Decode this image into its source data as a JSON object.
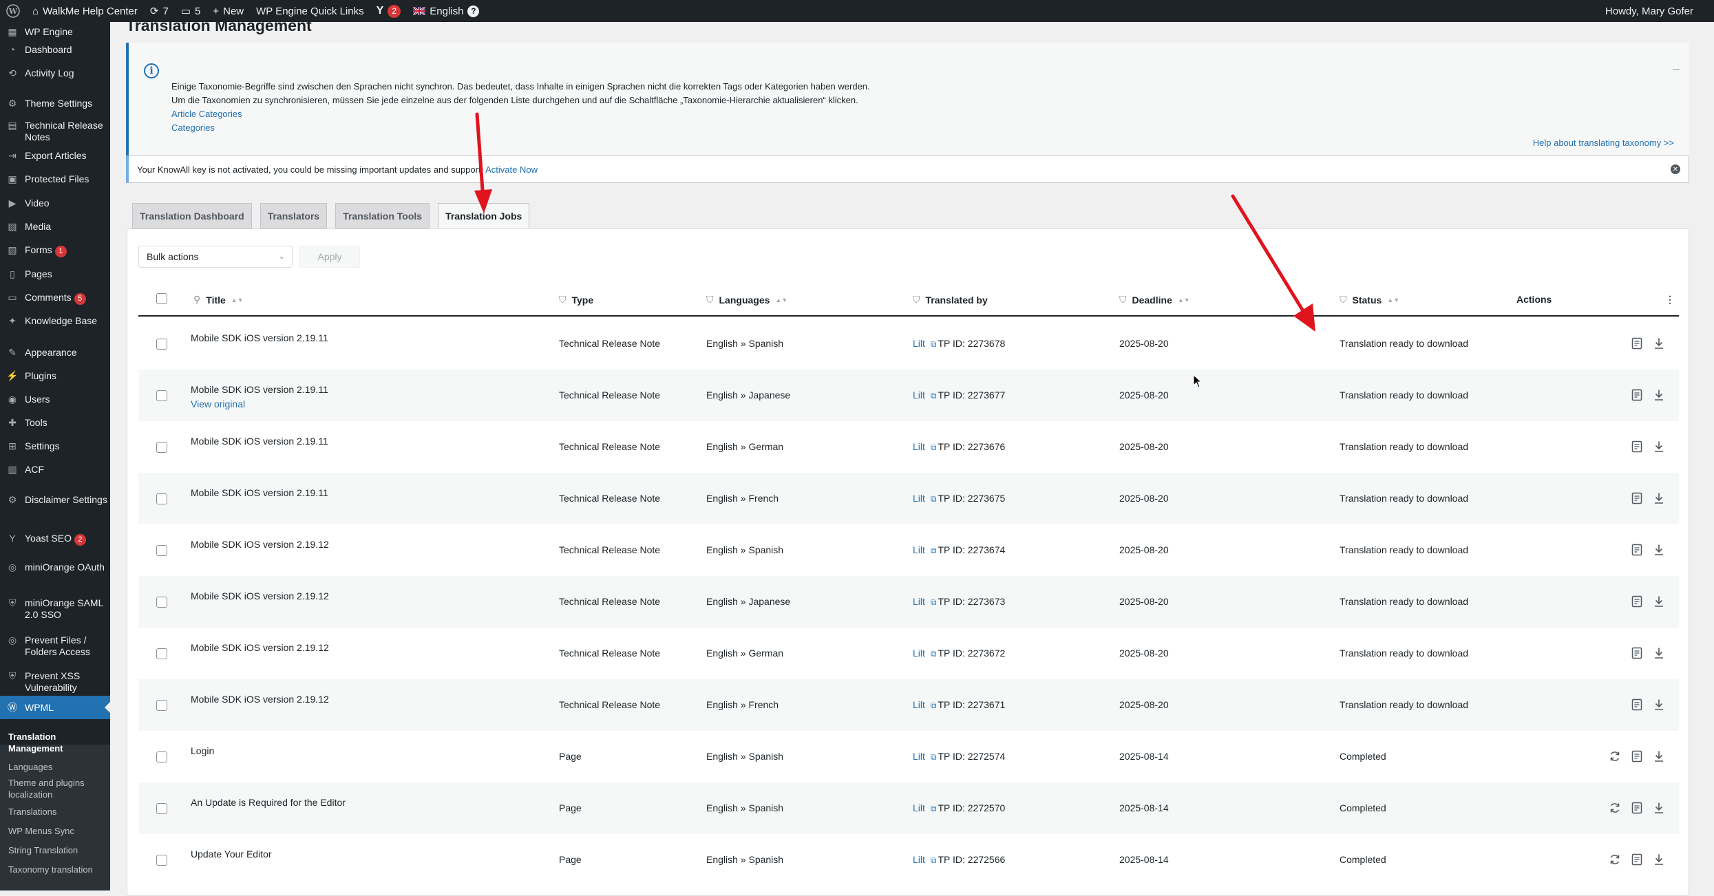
{
  "adminbar": {
    "site_name": "WalkMe Help Center",
    "updates_count": "7",
    "comments_count": "5",
    "new_label": "New",
    "quick_links": "WP Engine Quick Links",
    "yoast_count": "2",
    "language": "English",
    "howdy": "Howdy, Mary Gofer"
  },
  "sidebar": {
    "items": [
      {
        "label": "WP Engine",
        "icon": "wpengine-icon"
      },
      {
        "label": "Dashboard",
        "icon": "dashboard-icon"
      },
      {
        "label": "Activity Log",
        "icon": "history-icon"
      },
      {
        "label": "Theme Settings",
        "icon": "gear-icon"
      },
      {
        "label": "Technical Release Notes",
        "icon": "notes-icon"
      },
      {
        "label": "Export Articles",
        "icon": "export-icon"
      },
      {
        "label": "Protected Files",
        "icon": "lock-icon"
      },
      {
        "label": "Video",
        "icon": "video-icon"
      },
      {
        "label": "Media",
        "icon": "media-icon"
      },
      {
        "label": "Forms",
        "icon": "forms-icon",
        "badge": "1"
      },
      {
        "label": "Pages",
        "icon": "pages-icon"
      },
      {
        "label": "Comments",
        "icon": "comments-icon",
        "badge": "5"
      },
      {
        "label": "Knowledge Base",
        "icon": "lightbulb-icon"
      },
      {
        "label": "Appearance",
        "icon": "appearance-icon"
      },
      {
        "label": "Plugins",
        "icon": "plugins-icon"
      },
      {
        "label": "Users",
        "icon": "users-icon"
      },
      {
        "label": "Tools",
        "icon": "tools-icon"
      },
      {
        "label": "Settings",
        "icon": "settings-icon"
      },
      {
        "label": "ACF",
        "icon": "acf-icon"
      },
      {
        "label": "Disclaimer Settings",
        "icon": "gear-icon"
      },
      {
        "label": "Yoast SEO",
        "icon": "yoast-icon",
        "badge": "2"
      },
      {
        "label": "miniOrange OAuth",
        "icon": "miniorange-icon"
      },
      {
        "label": "miniOrange SAML 2.0 SSO",
        "icon": "shield-icon"
      },
      {
        "label": "Prevent Files / Folders Access",
        "icon": "miniorange-icon"
      },
      {
        "label": "Prevent XSS Vulnerability",
        "icon": "shield-icon"
      },
      {
        "label": "WPML",
        "icon": "wpml-icon"
      }
    ],
    "submenu": [
      "Translation Management",
      "Languages",
      "Theme and plugins localization",
      "Translations",
      "WP Menus Sync",
      "String Translation",
      "Taxonomy translation"
    ]
  },
  "page": {
    "title": "Translation Management",
    "notice": {
      "line1": "Einige Taxonomie-Begriffe sind zwischen den Sprachen nicht synchron. Das bedeutet, dass Inhalte in einigen Sprachen nicht die korrekten Tags oder Kategorien haben werden.",
      "line2": "Um die Taxonomien zu synchronisieren, müssen Sie jede einzelne aus der folgenden Liste durchgehen und auf die Schaltfläche „Taxonomie-Hierarchie aktualisieren“ klicken.",
      "link1": "Article Categories",
      "link2": "Categories",
      "help": "Help about translating taxonomy >>"
    },
    "key_notice": {
      "text": "Your KnowAll key is not activated, you could be missing important updates and support.",
      "link": "Activate Now"
    },
    "tabs": [
      "Translation Dashboard",
      "Translators",
      "Translation Tools",
      "Translation Jobs"
    ],
    "bulk_actions": "Bulk actions",
    "apply": "Apply",
    "columns": {
      "title": "Title",
      "type": "Type",
      "languages": "Languages",
      "translated_by": "Translated by",
      "deadline": "Deadline",
      "status": "Status",
      "actions": "Actions"
    },
    "view_original": "View original",
    "rows": [
      {
        "title": "Mobile SDK iOS version 2.19.11",
        "type": "Technical Release Note",
        "languages": "English » Spanish",
        "translator": "Lilt",
        "tp": "TP ID: 2273678",
        "deadline": "2025-08-20",
        "status": "Translation ready to download"
      },
      {
        "title": "Mobile SDK iOS version 2.19.11",
        "type": "Technical Release Note",
        "languages": "English » Japanese",
        "translator": "Lilt",
        "tp": "TP ID: 2273677",
        "deadline": "2025-08-20",
        "status": "Translation ready to download"
      },
      {
        "title": "Mobile SDK iOS version 2.19.11",
        "type": "Technical Release Note",
        "languages": "English » German",
        "translator": "Lilt",
        "tp": "TP ID: 2273676",
        "deadline": "2025-08-20",
        "status": "Translation ready to download"
      },
      {
        "title": "Mobile SDK iOS version 2.19.11",
        "type": "Technical Release Note",
        "languages": "English » French",
        "translator": "Lilt",
        "tp": "TP ID: 2273675",
        "deadline": "2025-08-20",
        "status": "Translation ready to download"
      },
      {
        "title": "Mobile SDK iOS version 2.19.12",
        "type": "Technical Release Note",
        "languages": "English » Spanish",
        "translator": "Lilt",
        "tp": "TP ID: 2273674",
        "deadline": "2025-08-20",
        "status": "Translation ready to download"
      },
      {
        "title": "Mobile SDK iOS version 2.19.12",
        "type": "Technical Release Note",
        "languages": "English » Japanese",
        "translator": "Lilt",
        "tp": "TP ID: 2273673",
        "deadline": "2025-08-20",
        "status": "Translation ready to download"
      },
      {
        "title": "Mobile SDK iOS version 2.19.12",
        "type": "Technical Release Note",
        "languages": "English » German",
        "translator": "Lilt",
        "tp": "TP ID: 2273672",
        "deadline": "2025-08-20",
        "status": "Translation ready to download"
      },
      {
        "title": "Mobile SDK iOS version 2.19.12",
        "type": "Technical Release Note",
        "languages": "English » French",
        "translator": "Lilt",
        "tp": "TP ID: 2273671",
        "deadline": "2025-08-20",
        "status": "Translation ready to download"
      },
      {
        "title": "Login",
        "type": "Page",
        "languages": "English » Spanish",
        "translator": "Lilt",
        "tp": "TP ID: 2272574",
        "deadline": "2025-08-14",
        "status": "Completed"
      },
      {
        "title": "An Update is Required for the Editor",
        "type": "Page",
        "languages": "English » Spanish",
        "translator": "Lilt",
        "tp": "TP ID: 2272570",
        "deadline": "2025-08-14",
        "status": "Completed"
      },
      {
        "title": "Update Your Editor",
        "type": "Page",
        "languages": "English » Spanish",
        "translator": "Lilt",
        "tp": "TP ID: 2272566",
        "deadline": "2025-08-14",
        "status": "Completed"
      }
    ]
  },
  "colors": {
    "accent": "#2271b1",
    "adminbar": "#1d2327",
    "annotation_arrow": "#e0141e"
  }
}
